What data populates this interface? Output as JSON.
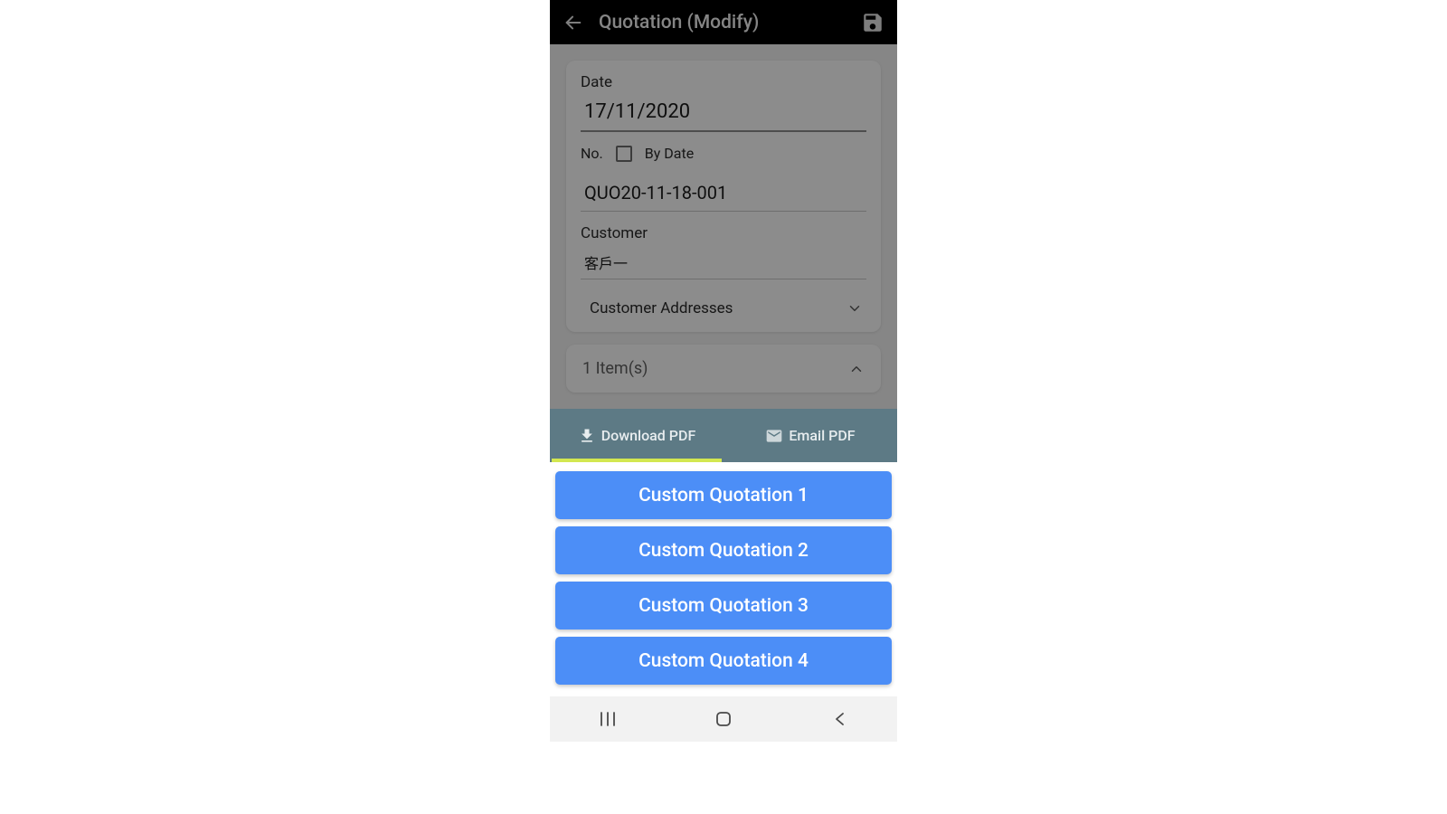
{
  "header": {
    "title": "Quotation (Modify)"
  },
  "form": {
    "date_label": "Date",
    "date_value": "17/11/2020",
    "no_label": "No.",
    "by_date_label": "By Date",
    "no_value": "QUO20-11-18-001",
    "customer_label": "Customer",
    "customer_value": "客戶一",
    "addresses_label": "Customer Addresses",
    "items_label": "1 Item(s)"
  },
  "tabs": {
    "download": "Download PDF",
    "email": "Email PDF"
  },
  "options": [
    "Custom Quotation 1",
    "Custom Quotation 2",
    "Custom Quotation 3",
    "Custom Quotation 4"
  ]
}
